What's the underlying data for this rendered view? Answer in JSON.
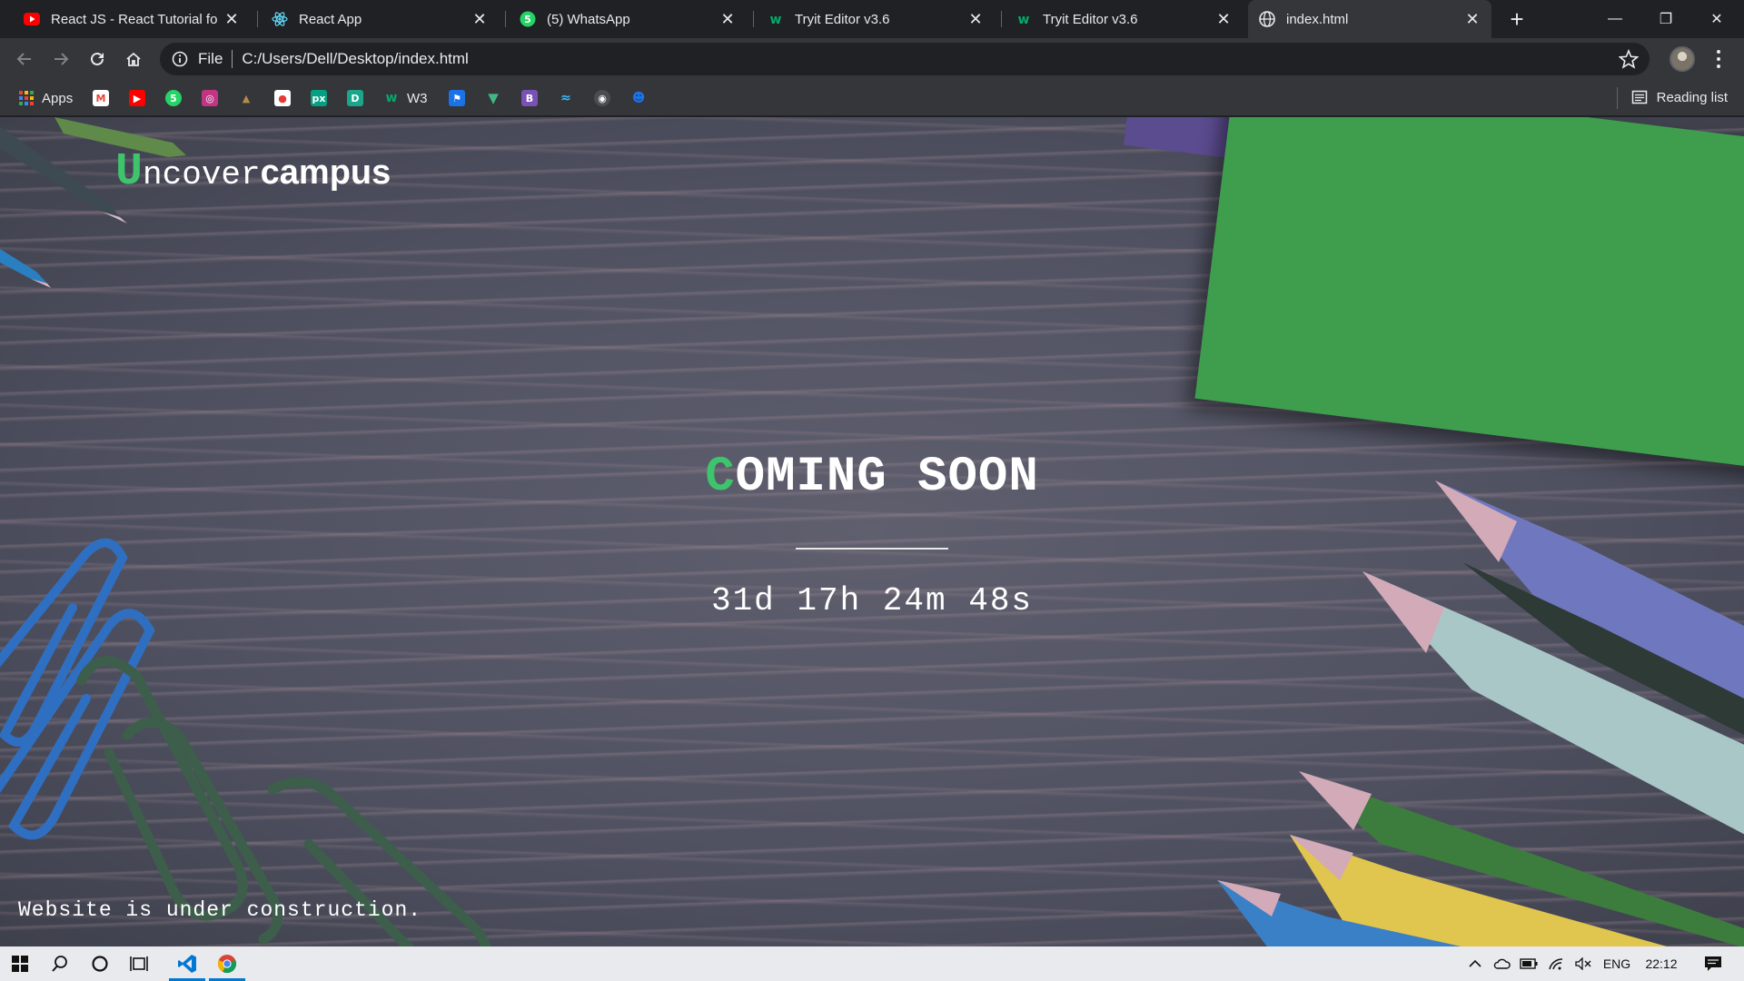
{
  "tabs": [
    {
      "title": "React JS - React Tutorial for E",
      "icon": "youtube-icon",
      "color": "#ff0000"
    },
    {
      "title": "React App",
      "icon": "react-icon",
      "color": "#61dafb"
    },
    {
      "title": "(5) WhatsApp",
      "icon": "whatsapp-icon",
      "color": "#25d366"
    },
    {
      "title": "Tryit Editor v3.6",
      "icon": "w3schools-icon",
      "color": "#04aa6d"
    },
    {
      "title": "Tryit Editor v3.6",
      "icon": "w3schools-icon",
      "color": "#04aa6d"
    },
    {
      "title": "index.html",
      "icon": "globe-icon",
      "color": "#e8eaed"
    }
  ],
  "window_controls": {
    "minimize": "—",
    "restore": "❐",
    "close": "✕"
  },
  "address_bar": {
    "scheme_label": "File",
    "url": "C:/Users/Dell/Desktop/index.html"
  },
  "bookmarks": {
    "apps_label": "Apps",
    "w3_label": "W3",
    "reading_list_label": "Reading list",
    "items": [
      {
        "icon": "gmail-icon",
        "color": "#ea4335"
      },
      {
        "icon": "youtube-icon",
        "color": "#ff0000"
      },
      {
        "icon": "whatsapp-icon",
        "color": "#25d366"
      },
      {
        "icon": "instagram-icon",
        "color": "#c13584"
      },
      {
        "icon": "codechef-icon",
        "color": "#b58a4a"
      },
      {
        "icon": "record-icon",
        "color": "#e53935"
      },
      {
        "icon": "pexels-icon",
        "color": "#05a081"
      },
      {
        "icon": "d-icon",
        "color": "#1aa68a"
      },
      {
        "icon": "w3schools-icon",
        "color": "#04aa6d"
      },
      {
        "icon": "flag-icon",
        "color": "#1a73e8"
      },
      {
        "icon": "vue-icon",
        "color": "#41b883"
      },
      {
        "icon": "bootstrap-icon",
        "color": "#7952b3"
      },
      {
        "icon": "tailwind-icon",
        "color": "#38bdf8"
      },
      {
        "icon": "github-icon",
        "color": "#24292e"
      },
      {
        "icon": "robot-icon",
        "color": "#1a73e8"
      }
    ]
  },
  "page": {
    "brand_first": "U",
    "brand_rest_mono": "ncover",
    "brand_bold": "campus",
    "heading_first": "C",
    "heading_rest": "OMING SOON",
    "countdown": "31d 17h 24m 48s",
    "footer_note": "Website is under construction.",
    "accent_color": "#3ec46d"
  },
  "taskbar": {
    "language": "ENG",
    "time": "22:12"
  }
}
